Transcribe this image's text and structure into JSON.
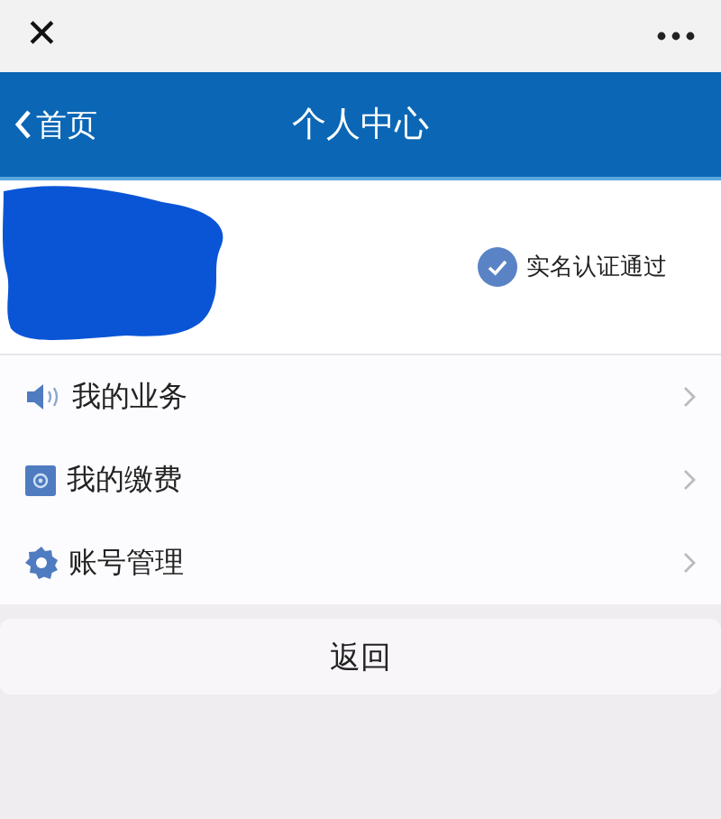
{
  "top_bar": {
    "close": "✕"
  },
  "header": {
    "back": "首页",
    "title": "个人中心"
  },
  "profile": {
    "verified": true,
    "verified_label": "实名认证通过"
  },
  "menu": [
    {
      "kind": "speaker",
      "label": "我的业务"
    },
    {
      "kind": "payment",
      "label": "我的缴费"
    },
    {
      "kind": "gear",
      "label": "账号管理"
    }
  ],
  "back_button": "返回"
}
